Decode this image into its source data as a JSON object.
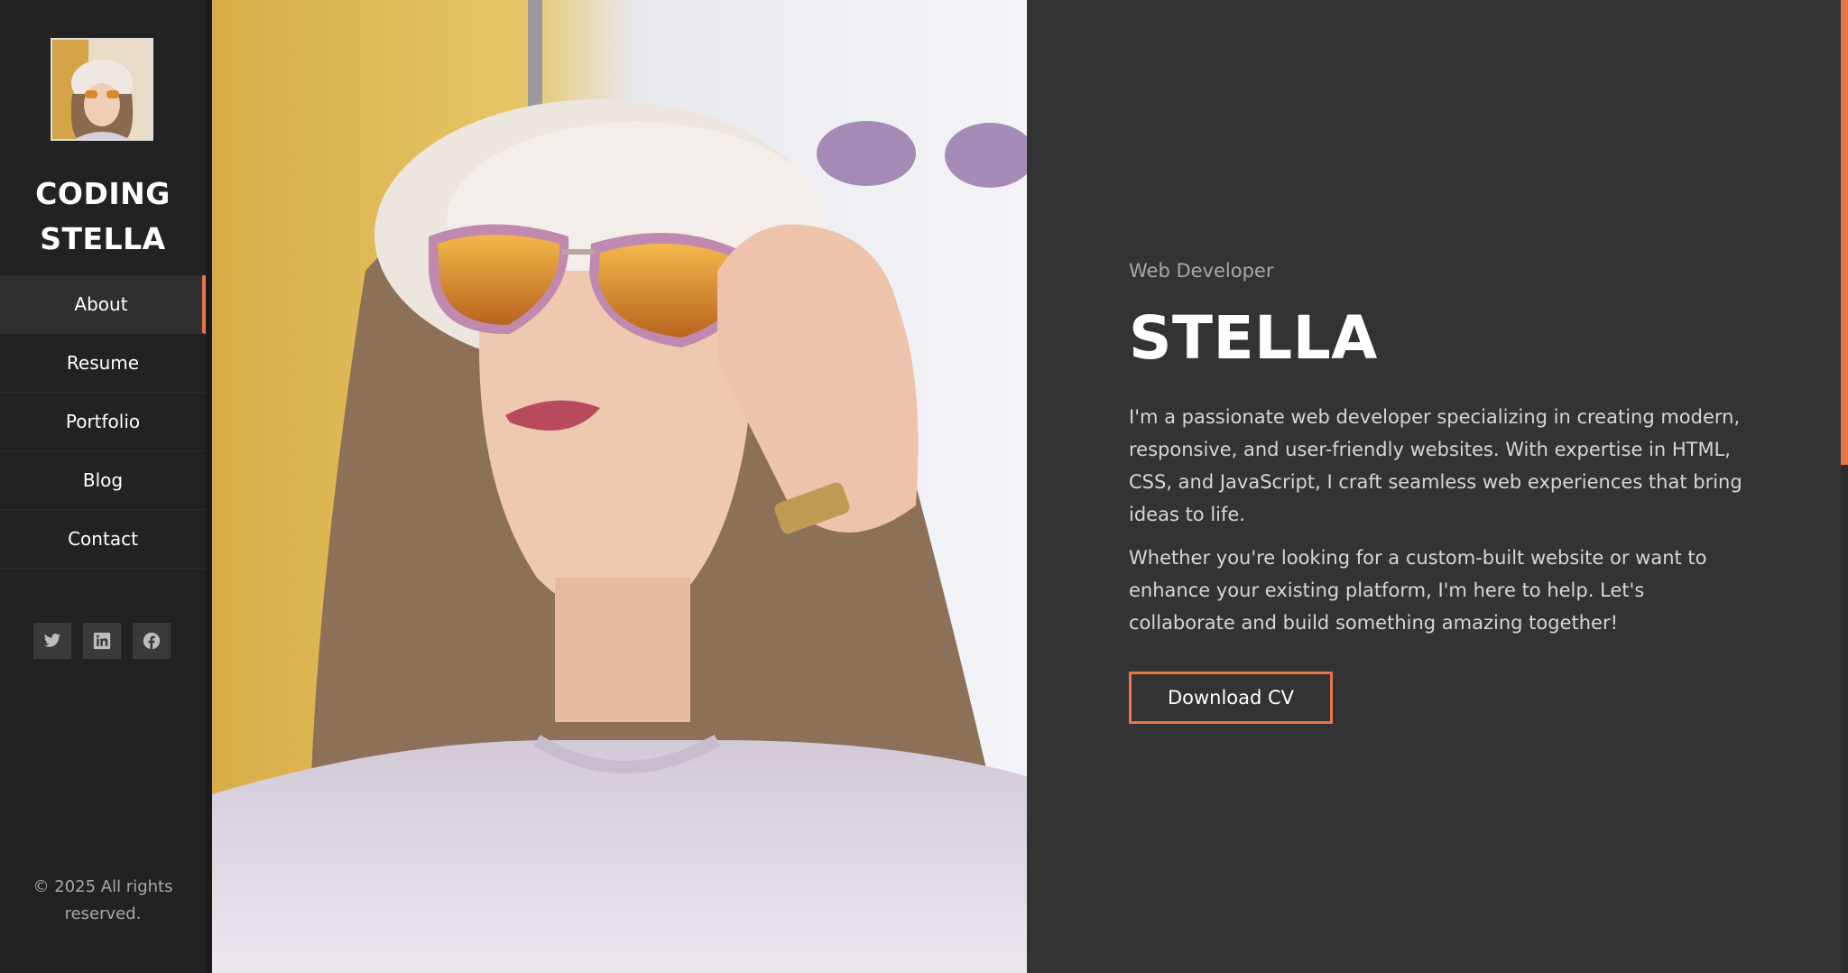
{
  "sidebar": {
    "logo_line1": "CODING",
    "logo_line2": "STELLA",
    "nav": [
      {
        "label": "About",
        "active": true
      },
      {
        "label": "Resume"
      },
      {
        "label": "Portfolio"
      },
      {
        "label": "Blog"
      },
      {
        "label": "Contact"
      }
    ],
    "social": [
      "twitter-icon",
      "linkedin-icon",
      "facebook-icon"
    ],
    "copyright": "© 2025 All rights reserved."
  },
  "hero": {
    "subtitle": "Web Developer",
    "name": "STELLA",
    "paragraph1": "I'm a passionate web developer specializing in creating modern, responsive, and user-friendly websites. With expertise in HTML, CSS, and JavaScript, I craft seamless web experiences that bring ideas to life.",
    "paragraph2": "Whether you're looking for a custom-built website or want to enhance your existing platform, I'm here to help. Let's collaborate and build something amazing together!",
    "button_label": "Download CV"
  },
  "colors": {
    "accent": "#e8744a",
    "background": "#333333",
    "sidebar": "#222222"
  }
}
